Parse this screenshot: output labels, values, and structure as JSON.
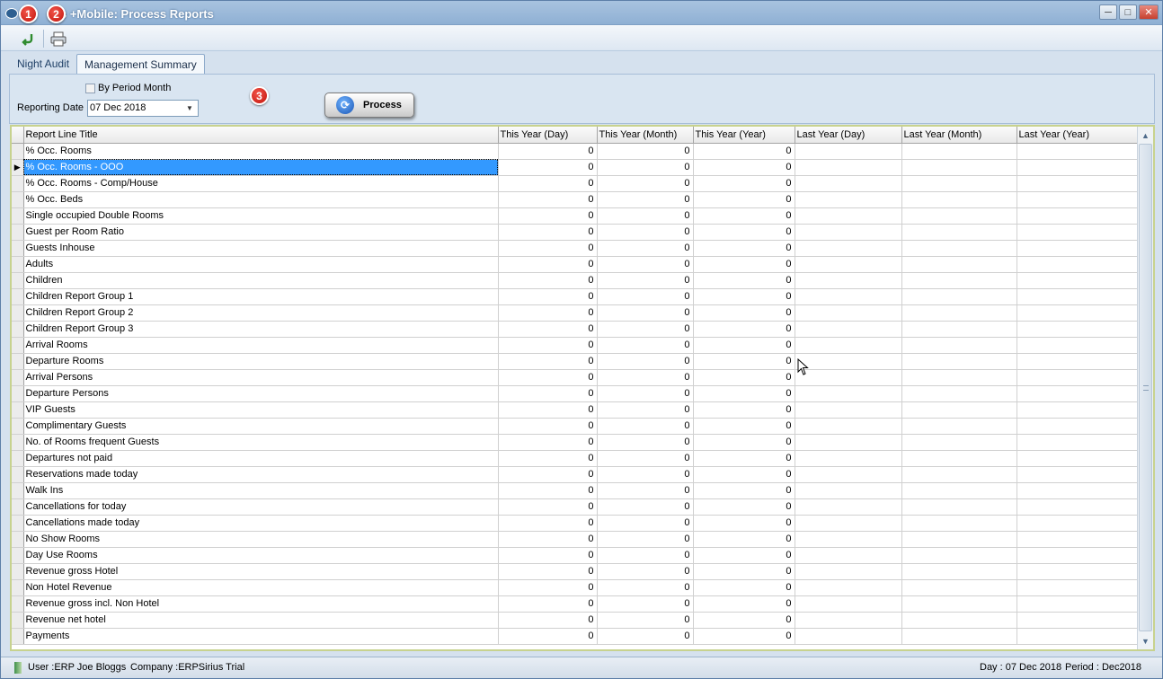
{
  "window": {
    "title": "s +Mobile: Process Reports",
    "controls": [
      "minimize",
      "maximize",
      "close"
    ]
  },
  "badges": [
    "1",
    "2",
    "3"
  ],
  "toolbar": {
    "buttons": [
      {
        "icon": "return-arrow-icon",
        "color": "#2e8b2e"
      },
      {
        "icon": "printer-icon"
      }
    ]
  },
  "tabs": [
    {
      "label": "Night Audit",
      "active": false
    },
    {
      "label": "Management Summary",
      "active": true
    }
  ],
  "options": {
    "by_period_month_label": "By Period Month",
    "by_period_month_checked": false,
    "reporting_date_label": "Reporting Date",
    "reporting_date_value": "07 Dec 2018"
  },
  "process_button": {
    "label": "Process"
  },
  "grid": {
    "columns": [
      "Report Line Title",
      "This Year (Day)",
      "This Year (Month)",
      "This Year (Year)",
      "Last Year (Day)",
      "Last Year (Month)",
      "Last Year (Year)"
    ],
    "selected_row": 1,
    "rows": [
      [
        "% Occ. Rooms",
        "0",
        "0",
        "0",
        "",
        "",
        ""
      ],
      [
        "% Occ. Rooms - OOO",
        "0",
        "0",
        "0",
        "",
        "",
        ""
      ],
      [
        "% Occ. Rooms - Comp/House",
        "0",
        "0",
        "0",
        "",
        "",
        ""
      ],
      [
        "% Occ.  Beds",
        "0",
        "0",
        "0",
        "",
        "",
        ""
      ],
      [
        "Single occupied Double Rooms",
        "0",
        "0",
        "0",
        "",
        "",
        ""
      ],
      [
        "Guest per Room Ratio",
        "0",
        "0",
        "0",
        "",
        "",
        ""
      ],
      [
        "Guests Inhouse",
        "0",
        "0",
        "0",
        "",
        "",
        ""
      ],
      [
        "Adults",
        "0",
        "0",
        "0",
        "",
        "",
        ""
      ],
      [
        "Children",
        "0",
        "0",
        "0",
        "",
        "",
        ""
      ],
      [
        "Children Report Group 1",
        "0",
        "0",
        "0",
        "",
        "",
        ""
      ],
      [
        "Children Report Group 2",
        "0",
        "0",
        "0",
        "",
        "",
        ""
      ],
      [
        "Children Report Group 3",
        "0",
        "0",
        "0",
        "",
        "",
        ""
      ],
      [
        "Arrival Rooms",
        "0",
        "0",
        "0",
        "",
        "",
        ""
      ],
      [
        "Departure Rooms",
        "0",
        "0",
        "0",
        "",
        "",
        ""
      ],
      [
        "Arrival Persons",
        "0",
        "0",
        "0",
        "",
        "",
        ""
      ],
      [
        "Departure Persons",
        "0",
        "0",
        "0",
        "",
        "",
        ""
      ],
      [
        "VIP Guests",
        "0",
        "0",
        "0",
        "",
        "",
        ""
      ],
      [
        "Complimentary Guests",
        "0",
        "0",
        "0",
        "",
        "",
        ""
      ],
      [
        "No. of Rooms frequent Guests",
        "0",
        "0",
        "0",
        "",
        "",
        ""
      ],
      [
        "Departures not paid",
        "0",
        "0",
        "0",
        "",
        "",
        ""
      ],
      [
        "Reservations made today",
        "0",
        "0",
        "0",
        "",
        "",
        ""
      ],
      [
        "Walk Ins",
        "0",
        "0",
        "0",
        "",
        "",
        ""
      ],
      [
        "Cancellations for today",
        "0",
        "0",
        "0",
        "",
        "",
        ""
      ],
      [
        "Cancellations made today",
        "0",
        "0",
        "0",
        "",
        "",
        ""
      ],
      [
        "No Show Rooms",
        "0",
        "0",
        "0",
        "",
        "",
        ""
      ],
      [
        "Day Use Rooms",
        "0",
        "0",
        "0",
        "",
        "",
        ""
      ],
      [
        "Revenue gross Hotel",
        "0",
        "0",
        "0",
        "",
        "",
        ""
      ],
      [
        "Non Hotel Revenue",
        "0",
        "0",
        "0",
        "",
        "",
        ""
      ],
      [
        "Revenue gross incl. Non Hotel",
        "0",
        "0",
        "0",
        "",
        "",
        ""
      ],
      [
        "Revenue net hotel",
        "0",
        "0",
        "0",
        "",
        "",
        ""
      ],
      [
        "Payments",
        "0",
        "0",
        "0",
        "",
        "",
        ""
      ]
    ]
  },
  "statusbar": {
    "user": "User :ERP Joe Bloggs",
    "company": "Company :ERPSirius Trial",
    "day": "Day : 07 Dec 2018",
    "period": "Period : Dec2018"
  }
}
